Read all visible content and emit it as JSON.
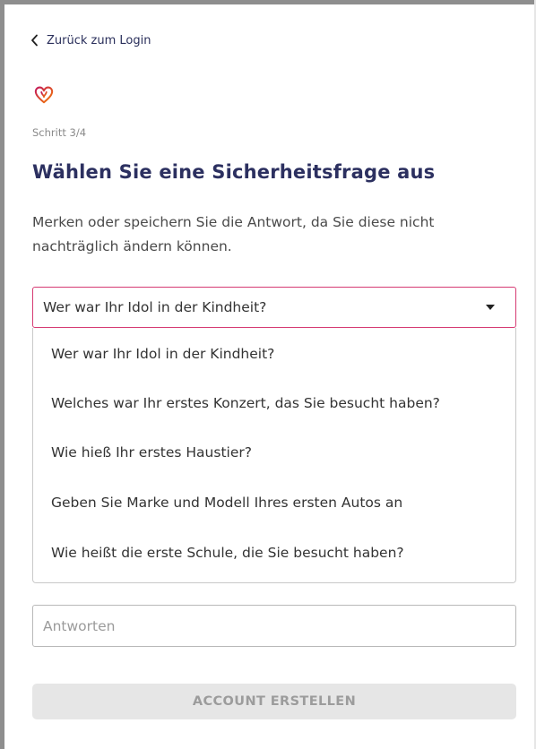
{
  "nav": {
    "back_label": "Zurück zum Login",
    "back_icon": "chevron-left-icon"
  },
  "brand": {
    "logo_icon": "heart-logo-icon",
    "gradient_start": "#c2185b",
    "gradient_end": "#f57c00"
  },
  "form": {
    "step": "Schritt 3/4",
    "title": "Wählen Sie eine Sicherheitsfrage aus",
    "description": "Merken oder speichern Sie die Antwort, da Sie diese nicht nachträglich ändern können.",
    "question_select": {
      "selected": "Wer war Ihr Idol in der Kindheit?",
      "options": [
        "Wer war Ihr Idol in der Kindheit?",
        "Welches war Ihr erstes Konzert, das Sie besucht haben?",
        "Wie hieß Ihr erstes Haustier?",
        "Geben Sie Marke und Modell Ihres ersten Autos an",
        "Wie heißt die erste Schule, die Sie besucht haben?"
      ],
      "border_color": "#d63b73"
    },
    "answer_placeholder": "Antworten",
    "submit_label": "ACCOUNT ERSTELLEN"
  },
  "colors": {
    "title": "#2c3060",
    "disabled_button_bg": "#e6e6e6",
    "disabled_button_text": "#9c9c9c"
  }
}
